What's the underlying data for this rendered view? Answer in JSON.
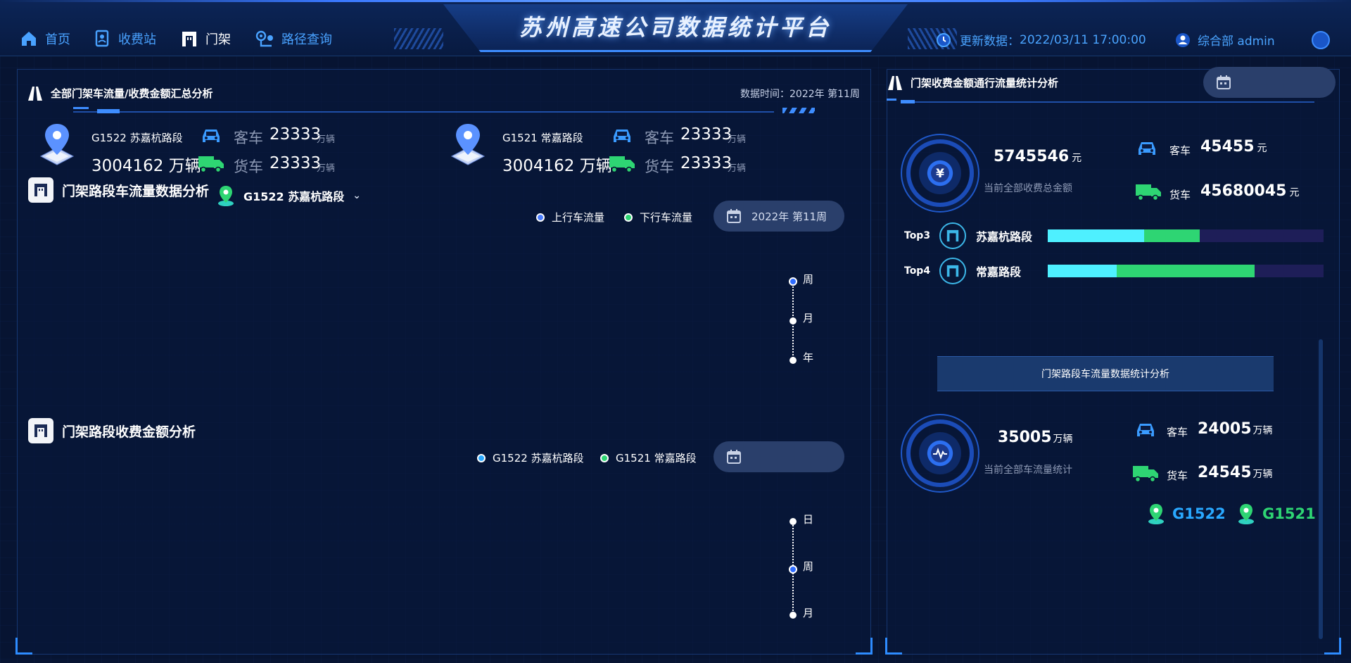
{
  "header": {
    "title": "苏州高速公司数据统计平台",
    "nav": [
      {
        "label": "首页",
        "icon": "home-icon"
      },
      {
        "label": "收费站",
        "icon": "toll-station-icon"
      },
      {
        "label": "门架",
        "icon": "gantry-icon",
        "active": true
      },
      {
        "label": "路径查询",
        "icon": "route-search-icon"
      }
    ],
    "update_label": "更新数据：",
    "update_time": "2022/03/11 17:00:00",
    "user": "综合部 admin"
  },
  "left": {
    "summary_title": "全部门架车流量/收费金额汇总分析",
    "data_time": "数据时间：2022年 第11周",
    "segments": [
      {
        "name": "G1522 苏嘉杭路段",
        "total": "3004162 万辆",
        "car_label": "客车",
        "car_value": "23333",
        "truck_label": "货车",
        "truck_value": "23333",
        "unit": "万辆"
      },
      {
        "name": "G1521 常嘉路段",
        "total": "3004162 万辆",
        "car_label": "客车",
        "car_value": "23333",
        "truck_label": "货车",
        "truck_value": "23333",
        "unit": "万辆"
      }
    ],
    "flow_section": {
      "title": "门架路段车流量数据分析",
      "selected_segment": "G1522 苏嘉杭路段",
      "legend": [
        "上行车流量",
        "下行车流量"
      ],
      "date": "2022年 第11周",
      "timeline": [
        "周",
        "月",
        "年"
      ],
      "timeline_active": 0
    },
    "toll_section": {
      "title": "门架路段收费金额分析",
      "legend": [
        "G1522 苏嘉杭路段",
        "G1521 常嘉路段"
      ],
      "date": "",
      "timeline": [
        "日",
        "周",
        "月"
      ],
      "timeline_active": 1
    }
  },
  "right": {
    "title": "门架收费金额通行流量统计分析",
    "amount": {
      "total": "5745546",
      "total_unit": "元",
      "caption": "当前全部收费总金额",
      "car_label": "客车",
      "car_value": "45455",
      "truck_label": "货车",
      "truck_value": "45680045",
      "unit": "元"
    },
    "ranking": [
      {
        "rank": "Top3",
        "name": "苏嘉杭路段",
        "cyan": 0.35,
        "green": 0.2
      },
      {
        "rank": "Top4",
        "name": "常嘉路段",
        "cyan": 0.25,
        "green": 0.5
      }
    ],
    "banner": "门架路段车流量数据统计分析",
    "flow": {
      "total": "35005",
      "total_unit": "万辆",
      "caption": "当前全部车流量统计",
      "car_label": "客车",
      "car_value": "24005",
      "truck_label": "货车",
      "truck_value": "24545",
      "unit": "万辆"
    },
    "roads": [
      "G1522",
      "G1521"
    ]
  },
  "colors": {
    "accent": "#3e8dff",
    "car": "#3a9bff",
    "truck": "#2ed573",
    "cyan": "#4ef0ff",
    "green": "#2ed573",
    "road1": "#29a8ff",
    "road2": "#2ed573"
  }
}
